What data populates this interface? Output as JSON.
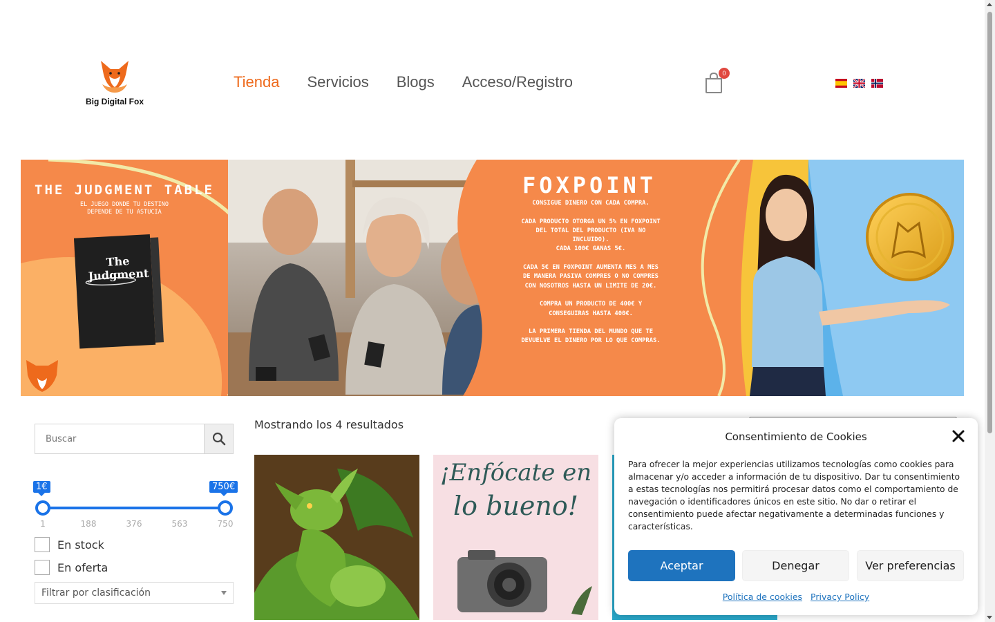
{
  "brand": {
    "name": "Big Digital Fox",
    "accent": "#ee6a1c"
  },
  "nav": {
    "items": [
      {
        "label": "Tienda",
        "active": true
      },
      {
        "label": "Servicios",
        "active": false
      },
      {
        "label": "Blogs",
        "active": false
      },
      {
        "label": "Acceso/Registro",
        "active": false
      }
    ]
  },
  "cart": {
    "count": "0",
    "icon": "shopping-bag-icon"
  },
  "languages": [
    "es",
    "en",
    "no"
  ],
  "banner": {
    "left_title": "THE JUDGMENT TABLE",
    "left_subtitle_1": "EL JUEGO DONDE TU DESTINO",
    "left_subtitle_2": "DEPENDE DE TU ASTUCIA",
    "box_title": "The Judgment",
    "center_title": "FOXPOINT",
    "center_lines": [
      "CONSIGUE DINERO CON CADA COMPRA.",
      "",
      "CADA PRODUCTO OTORGA UN 5% EN FOXPOINT",
      "DEL TOTAL DEL PRODUCTO (IVA NO",
      "INCLUIDO).",
      "CADA 100€ GANAS 5€.",
      "",
      "CADA 5€ EN FOXPOINT AUMENTA MES A MES",
      "DE MANERA PASIVA COMPRES O NO COMPRES",
      "CON NOSOTROS HASTA UN LIMITE DE 20€.",
      "",
      "COMPRA UN PRODUCTO DE 400€ Y",
      "CONSEGUIRAS HASTA 400€.",
      "",
      "LA PRIMERA TIENDA DEL MUNDO QUE TE",
      "DEVUELVE EL DINERO POR LO QUE COMPRAS."
    ]
  },
  "search": {
    "placeholder": "Buscar",
    "icon": "search-icon"
  },
  "price_filter": {
    "min_label": "1€",
    "max_label": "750€",
    "ticks": [
      "1",
      "188",
      "376",
      "563",
      "750"
    ]
  },
  "filters": {
    "in_stock": "En stock",
    "on_sale": "En oferta",
    "rating_select": "Filtrar por clasificación"
  },
  "results_text": "Mostrando los 4 resultados",
  "products": [
    {
      "name": "dragon-artwork"
    },
    {
      "name": "enfocate-en-lo-bueno",
      "overlay_line_1": "¡Enfócate en",
      "overlay_line_2": "lo bueno!"
    },
    {
      "name": "product-3"
    }
  ],
  "cookie": {
    "title": "Consentimiento de Cookies",
    "body": "Para ofrecer la mejor experiencias utilizamos tecnologías como cookies para almacenar y/o acceder a información de tu dispositivo. Dar tu consentimiento a estas tecnologías nos permitirá procesar datos como el comportamiento de navegación o identificadores únicos en este sitio. No dar o retirar el consentimiento puede afectar negativamente a determinadas funciones y características.",
    "accept": "Aceptar",
    "deny": "Denegar",
    "preferences": "Ver preferencias",
    "cookie_policy": "Política de cookies",
    "privacy_policy": "Privacy Policy"
  }
}
